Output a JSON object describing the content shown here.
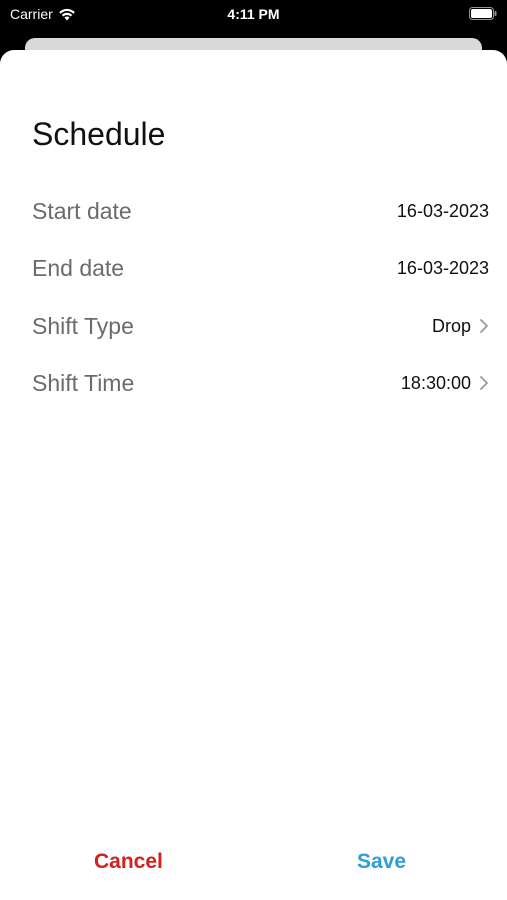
{
  "status_bar": {
    "carrier": "Carrier",
    "time": "4:11 PM"
  },
  "schedule": {
    "title": "Schedule",
    "rows": [
      {
        "label": "Start date",
        "value": "16-03-2023"
      },
      {
        "label": "End date",
        "value": "16-03-2023"
      },
      {
        "label": "Shift Type",
        "value": "Drop"
      },
      {
        "label": "Shift Time",
        "value": "18:30:00"
      }
    ]
  },
  "footer": {
    "cancel_label": "Cancel",
    "save_label": "Save"
  },
  "colors": {
    "cancel": "#d0221f",
    "save": "#2a9fd8",
    "background_dim": "#000000",
    "sheet": "#ffffff"
  },
  "icons": {
    "wifi": "wifi-icon",
    "battery": "battery-icon",
    "chevron": "chevron-right-icon"
  }
}
